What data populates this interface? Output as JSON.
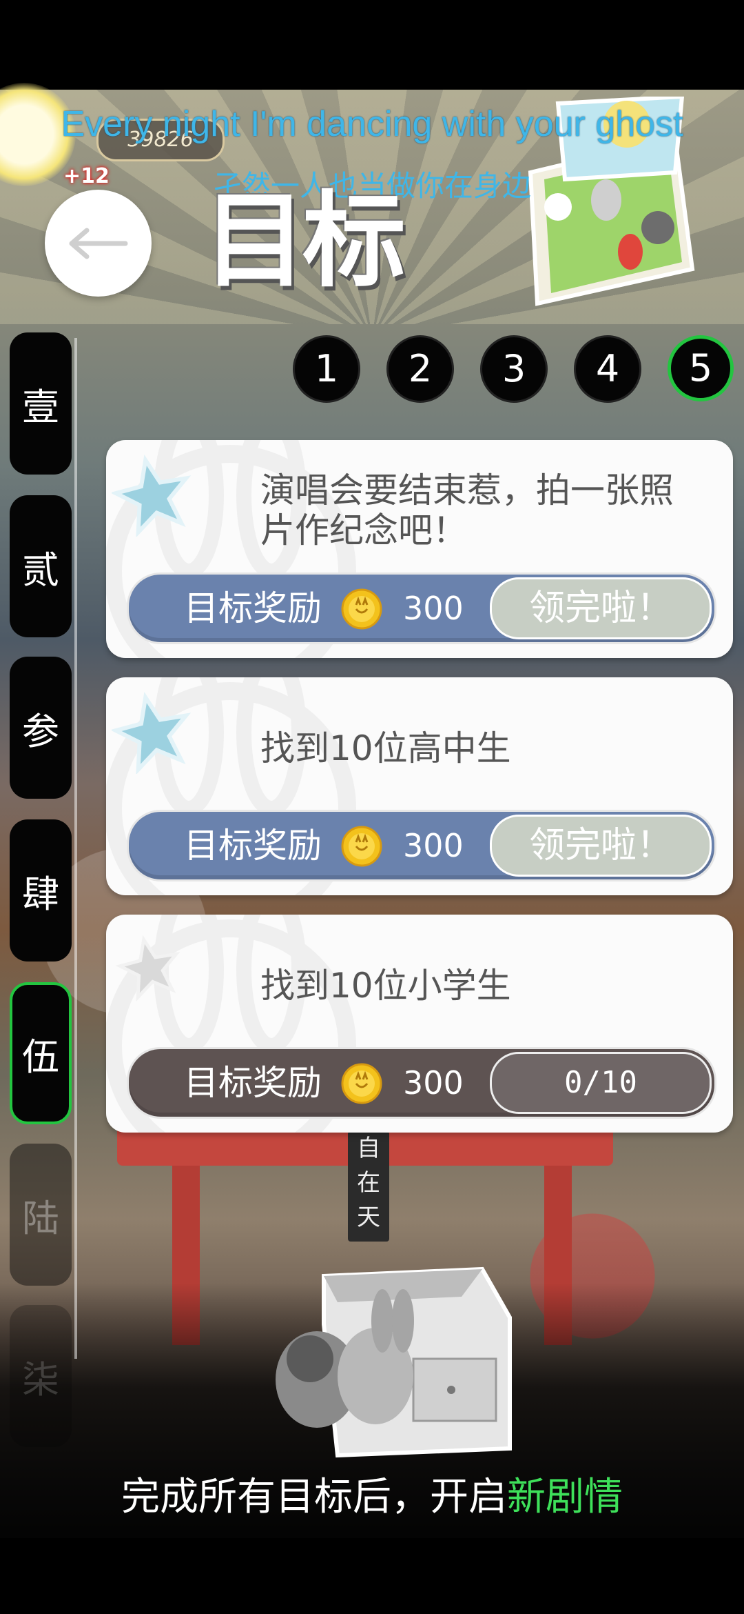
{
  "status": {
    "coins": "39826",
    "coin_gain": "+12"
  },
  "lyrics": {
    "english": "Every night I'm dancing with your ghost",
    "chinese": "孑然一人也当做你在身边"
  },
  "header": {
    "title": "目标",
    "back_icon": "back-arrow-icon"
  },
  "steps": [
    "1",
    "2",
    "3",
    "4",
    "5"
  ],
  "active_step": "5",
  "chapters": [
    {
      "label": "壹",
      "state": "normal"
    },
    {
      "label": "贰",
      "state": "normal"
    },
    {
      "label": "参",
      "state": "normal"
    },
    {
      "label": "肆",
      "state": "normal"
    },
    {
      "label": "伍",
      "state": "active"
    },
    {
      "label": "陆",
      "state": "locked"
    },
    {
      "label": "柒",
      "state": "locked"
    }
  ],
  "goals": [
    {
      "text": "演唱会要结束惹，拍一张照片作纪念吧！",
      "reward_label": "目标奖励",
      "reward_amount": "300",
      "button_label": "领完啦！",
      "status": "claimed"
    },
    {
      "text": "找到10位高中生",
      "reward_label": "目标奖励",
      "reward_amount": "300",
      "button_label": "领完啦！",
      "status": "claimed"
    },
    {
      "text": "找到10位小学生",
      "reward_label": "目标奖励",
      "reward_amount": "300",
      "progress": "0/10",
      "status": "in_progress"
    }
  ],
  "footer": {
    "hint_prefix": "完成所有目标后，开启",
    "hint_highlight": "新剧情"
  },
  "scene": {
    "shrine_sign": "自在天"
  },
  "colors": {
    "accent_green": "#23c540",
    "reward_bar_blue": "#6a82ad",
    "reward_bar_locked": "#5e5352",
    "claimed_button": "#c7cec4",
    "lyric_blue": "#3fb6e8",
    "highlight_green": "#3ee05a"
  }
}
